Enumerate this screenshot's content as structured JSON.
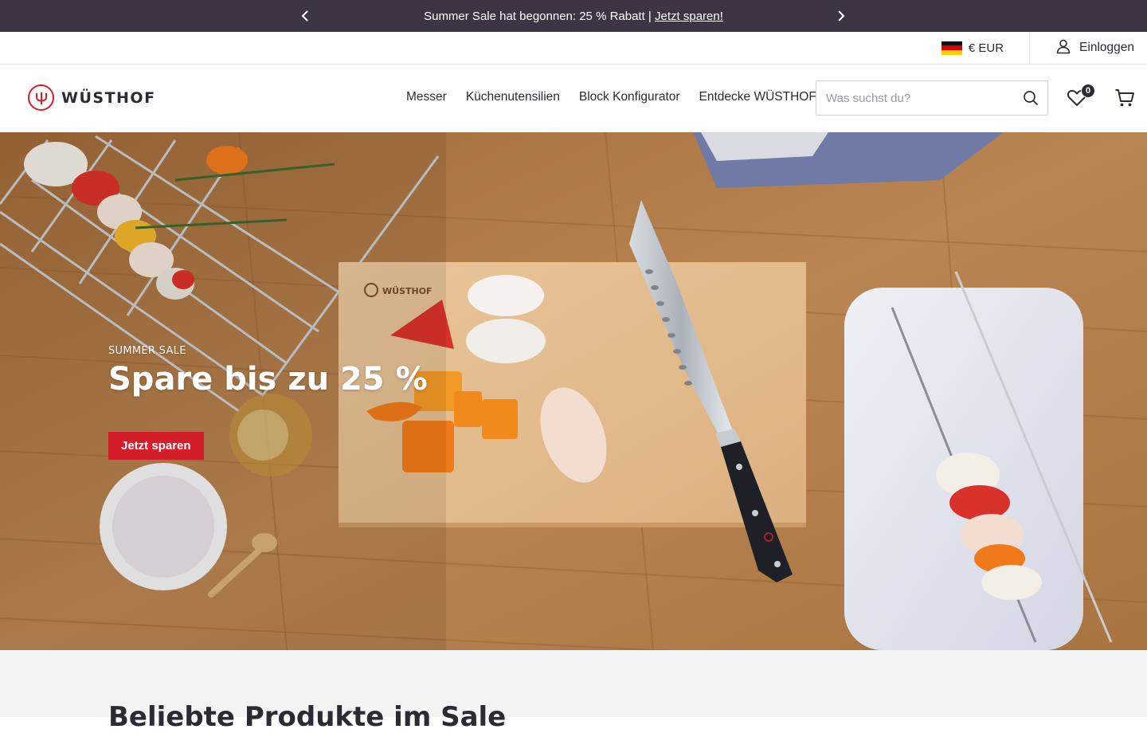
{
  "announcement": {
    "text": "Summer Sale hat begonnen: 25 % Rabatt | ",
    "link": "Jetzt sparen!"
  },
  "utility": {
    "currency": "€ EUR",
    "login": "Einloggen"
  },
  "brand": {
    "name": "WÜSTHOF",
    "accent": "#d41f2b"
  },
  "nav": {
    "items": [
      "Messer",
      "Küchenutensilien",
      "Block Konfigurator",
      "Entdecke WÜSTHOF"
    ]
  },
  "search": {
    "placeholder": "Was suchst du?"
  },
  "wishlist": {
    "count": "0"
  },
  "hero": {
    "eyebrow": "SUMMER SALE",
    "headline": "Spare bis zu 25 %",
    "cta": "Jetzt sparen",
    "board_brand": "WÜSTHOF"
  },
  "section": {
    "title": "Beliebte Produkte im Sale"
  },
  "icons": {
    "prev": "chevron-left-icon",
    "next": "chevron-right-icon",
    "user": "user-icon",
    "search": "search-icon",
    "wishlist": "heart-icon",
    "cart": "cart-icon"
  },
  "colors": {
    "announce_bg": "#3e3444",
    "text": "#2b2b33",
    "cta": "#d41f2b"
  }
}
